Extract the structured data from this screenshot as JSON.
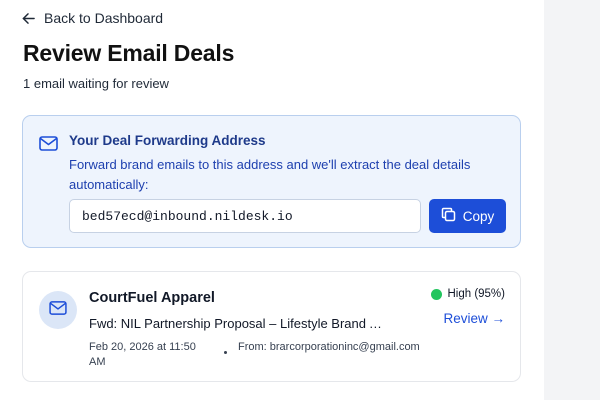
{
  "nav": {
    "back_label": "Back to Dashboard"
  },
  "header": {
    "title": "Review Email Deals",
    "subtitle": "1 email waiting for review"
  },
  "forwarding": {
    "title": "Your Deal Forwarding Address",
    "description": "Forward brand emails to this address and we'll extract the deal details automatically:",
    "address": "bed57ecd@inbound.nildesk.io",
    "copy_label": "Copy"
  },
  "emails": [
    {
      "sender": "CourtFuel Apparel",
      "subject": "Fwd: NIL Partnership Proposal – Lifestyle Brand Ambassador",
      "date": "Feb 20, 2026 at 11:50 AM",
      "from": "From: brarcorporationinc@gmail.com",
      "confidence": "High (95%)",
      "review_label": "Review →"
    }
  ],
  "icons": {
    "back": "arrow-left-icon",
    "mail": "mail-icon",
    "copy": "copy-icon"
  },
  "colors": {
    "accent": "#1d4ed8",
    "card_bg": "#eef4fd",
    "card_border": "#b9cfee",
    "title_blue": "#1e3a8a",
    "confidence_high": "#22c55e"
  }
}
